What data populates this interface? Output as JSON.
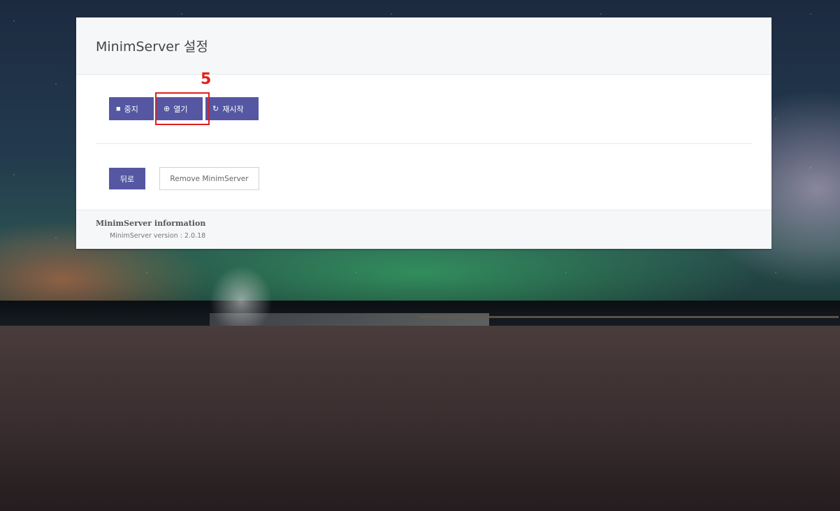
{
  "panel": {
    "title": "MinimServer 설정"
  },
  "controls": {
    "stop_label": "중지",
    "open_label": "열기",
    "restart_label": "재시작",
    "stop_icon": "square-icon",
    "open_icon": "plus-circle-icon",
    "restart_icon": "refresh-icon"
  },
  "annotation": {
    "step": "5",
    "color": "#e0201e"
  },
  "actions": {
    "back_label": "뒤로",
    "remove_label": "Remove MinimServer"
  },
  "footer": {
    "info_title": "MinimServer information",
    "version_text": "MinimServer version : 2.0.18"
  },
  "colors": {
    "button": "#5557a3",
    "panel_header": "#f5f7f8"
  }
}
